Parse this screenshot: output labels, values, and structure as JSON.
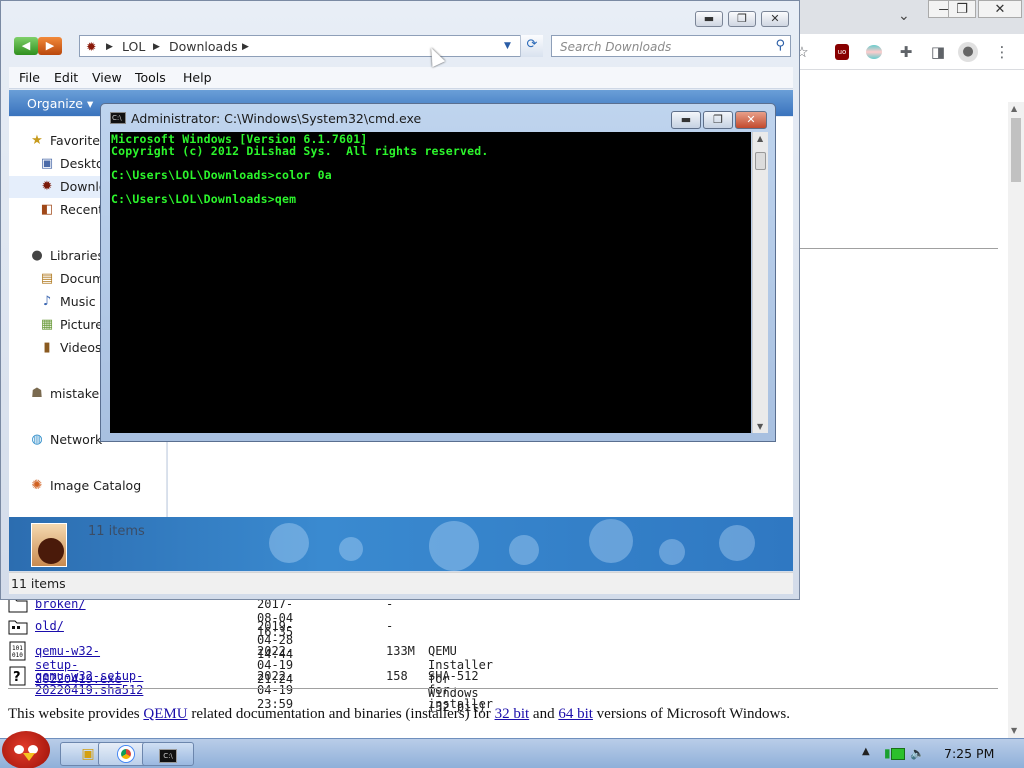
{
  "chrome": {
    "window_buttons": [
      "—",
      "❐",
      "✕"
    ],
    "dropdown": "⌄",
    "extension_icons": [
      "☆",
      "uBlock",
      "tab-icon",
      "puzzle",
      "sidebar",
      "profile",
      "menu"
    ]
  },
  "webpage": {
    "rows": [
      {
        "name": "broken/",
        "date": "2017-08-04 16:35",
        "size": "-",
        "desc": ""
      },
      {
        "name": "old/",
        "date": "2019-04-28 14:44",
        "size": "-",
        "desc": ""
      },
      {
        "name": "qemu-w32-setup-20220419.exe",
        "date": "2022-04-19 21:24",
        "size": "133M",
        "desc": "QEMU Installer for Windows (32 bit)"
      },
      {
        "name": "qemu-w32-setup-20220419.sha512",
        "date": "2022-04-19 23:59",
        "size": "158",
        "desc": "SHA-512 for installer"
      }
    ],
    "footer": {
      "pre": "This website provides ",
      "link_qemu": "QEMU",
      "mid1": " related documentation and binaries (installers) for ",
      "link_32": "32 bit",
      "mid2": " and ",
      "link_64": "64 bit",
      "post": " versions of Microsoft Windows."
    }
  },
  "explorer": {
    "address": {
      "seg1": "LOL",
      "seg2": "Downloads"
    },
    "search_placeholder": "Search Downloads",
    "menu": [
      "File",
      "Edit",
      "View",
      "Tools",
      "Help"
    ],
    "organize": "Organize ▾",
    "nav": [
      {
        "label": "Favorites",
        "icon": "★"
      },
      {
        "label": "Desktop",
        "icon": "▣"
      },
      {
        "label": "Downloads",
        "icon": "✹"
      },
      {
        "label": "Recent Places",
        "icon": "◧"
      },
      {
        "label": "Libraries",
        "icon": "●"
      },
      {
        "label": "Documents",
        "icon": "▤"
      },
      {
        "label": "Music",
        "icon": "♪"
      },
      {
        "label": "Pictures",
        "icon": "▦"
      },
      {
        "label": "Videos",
        "icon": "▮"
      },
      {
        "label": "mistake",
        "icon": "☗"
      },
      {
        "label": "Network",
        "icon": "◍"
      },
      {
        "label": "Image Catalog",
        "icon": "✺"
      }
    ],
    "details_count": "11 items",
    "status": "11 items"
  },
  "cmd": {
    "title": "Administrator: C:\\Windows\\System32\\cmd.exe",
    "lines": [
      "Microsoft Windows [Version 6.1.7601]",
      "Copyright (c) 2012 DiLshad Sys.  All rights reserved.",
      "",
      "C:\\Users\\LOL\\Downloads>color 0a",
      "",
      "C:\\Users\\LOL\\Downloads>qem"
    ]
  },
  "taskbar": {
    "clock": "7:25 PM"
  }
}
